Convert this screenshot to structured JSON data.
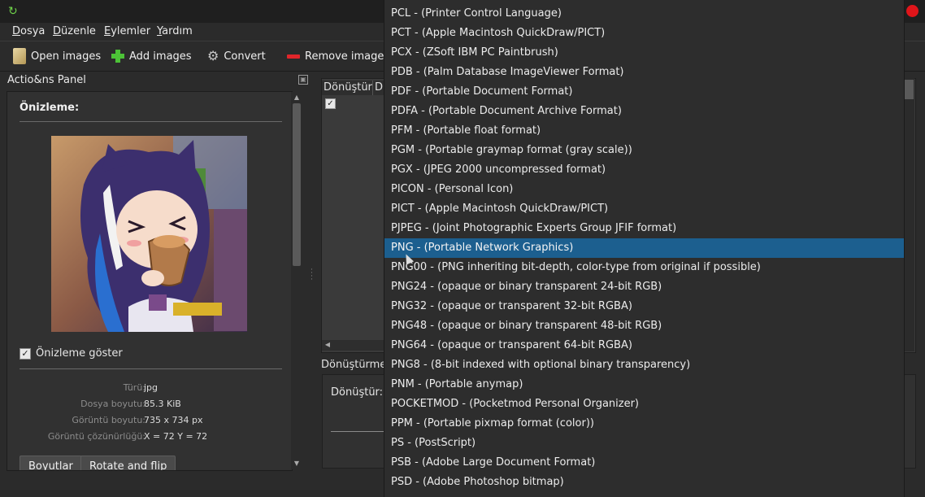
{
  "menu": {
    "items": [
      {
        "u": "D",
        "rest": "osya"
      },
      {
        "u": "D",
        "rest": "üzenle"
      },
      {
        "u": "E",
        "rest": "ylemler"
      },
      {
        "u": "Y",
        "rest": "ardım"
      }
    ]
  },
  "toolbar": {
    "open_images": "Open images",
    "add_images": "Add images",
    "convert": "Convert",
    "remove_images": "Remove images"
  },
  "panel": {
    "title": "Actio&ns Panel",
    "preview_heading": "Önizleme:",
    "show_preview_label": "Önizleme göster",
    "show_preview_checked": true,
    "info": [
      {
        "key": "Türü:",
        "value": "jpg"
      },
      {
        "key": "Dosya boyutu:",
        "value": "85.3 KiB"
      },
      {
        "key": "Görüntü boyutu:",
        "value": "735 x 734 px"
      },
      {
        "key": "Görüntü çözünürlüğü:",
        "value": "X = 72 Y = 72"
      }
    ],
    "tabs": [
      "Boyutlar",
      "Rotate and flip"
    ]
  },
  "table": {
    "headers": [
      "Dönüştür",
      "D"
    ],
    "row_checked": true
  },
  "convert": {
    "section_label": "Dönüştürme",
    "label": "Dönüştür:"
  },
  "dropdown": {
    "selected_index": 12,
    "items": [
      "PCL - (Printer Control Language)",
      "PCT - (Apple Macintosh QuickDraw/PICT)",
      "PCX - (ZSoft IBM PC Paintbrush)",
      "PDB - (Palm Database ImageViewer Format)",
      "PDF - (Portable Document Format)",
      "PDFA - (Portable Document Archive Format)",
      "PFM - (Portable float format)",
      "PGM - (Portable graymap format (gray scale))",
      "PGX - (JPEG 2000 uncompressed format)",
      "PICON - (Personal Icon)",
      "PICT - (Apple Macintosh QuickDraw/PICT)",
      "PJPEG - (Joint Photographic Experts Group JFIF format)",
      "PNG - (Portable Network Graphics)",
      "PNG00 - (PNG inheriting bit-depth, color-type from original if possible)",
      "PNG24 - (opaque or binary transparent 24-bit RGB)",
      "PNG32 - (opaque or transparent 32-bit RGBA)",
      "PNG48 - (opaque or binary transparent 48-bit RGB)",
      "PNG64 - (opaque or transparent 64-bit RGBA)",
      "PNG8 - (8-bit indexed with optional binary transparency)",
      "PNM - (Portable anymap)",
      "POCKETMOD - (Pocketmod Personal Organizer)",
      "PPM - (Portable pixmap format (color))",
      "PS - (PostScript)",
      "PSB - (Adobe Large Document Format)",
      "PSD - (Adobe Photoshop bitmap)"
    ]
  },
  "colors": {
    "accent": "#1c5f8f",
    "close": "#e0151a",
    "add_green": "#4cc237",
    "remove_red": "#e0252a"
  }
}
